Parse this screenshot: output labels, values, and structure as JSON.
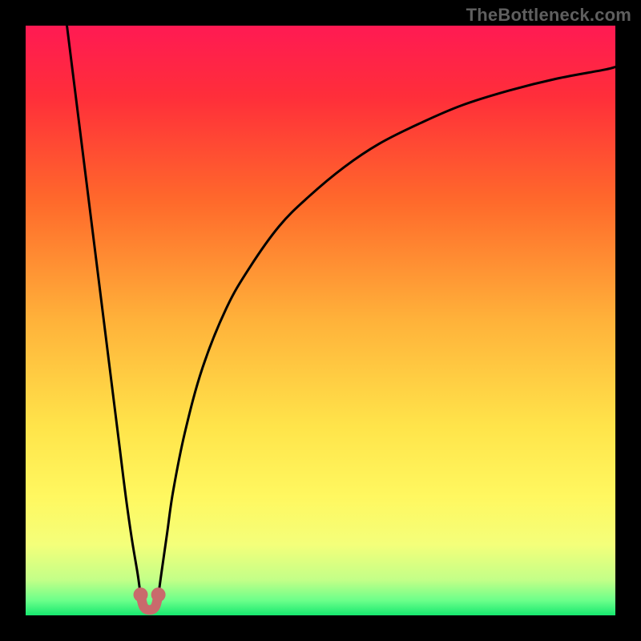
{
  "watermark": "TheBottleneck.com",
  "colors": {
    "frame": "#000000",
    "gradient_stops": [
      {
        "offset": 0.0,
        "color": "#ff1a53"
      },
      {
        "offset": 0.12,
        "color": "#ff2e3a"
      },
      {
        "offset": 0.3,
        "color": "#ff6a2b"
      },
      {
        "offset": 0.5,
        "color": "#ffb23a"
      },
      {
        "offset": 0.68,
        "color": "#ffe44a"
      },
      {
        "offset": 0.8,
        "color": "#fff860"
      },
      {
        "offset": 0.88,
        "color": "#f4ff7a"
      },
      {
        "offset": 0.94,
        "color": "#c3ff88"
      },
      {
        "offset": 0.975,
        "color": "#6bff8a"
      },
      {
        "offset": 1.0,
        "color": "#17e86f"
      }
    ],
    "curve": "#000000",
    "marker_fill": "#c96a6c",
    "marker_stroke": "#c96a6c"
  },
  "chart_data": {
    "type": "line",
    "title": "",
    "xlabel": "",
    "ylabel": "",
    "xlim": [
      0,
      100
    ],
    "ylim": [
      0,
      100
    ],
    "series": [
      {
        "name": "left-branch",
        "x": [
          7,
          8,
          9,
          10,
          11,
          12,
          13,
          14,
          15,
          16,
          17,
          18,
          19,
          19.5,
          20
        ],
        "values": [
          100,
          92,
          84,
          76,
          68,
          60,
          52,
          44,
          36,
          28,
          20,
          13,
          7,
          3.5,
          1.5
        ]
      },
      {
        "name": "right-branch",
        "x": [
          22,
          22.5,
          23,
          24,
          25,
          27,
          30,
          34,
          38,
          43,
          48,
          54,
          60,
          67,
          74,
          82,
          90,
          98,
          100
        ],
        "values": [
          1.5,
          3.5,
          7,
          14,
          21,
          31,
          42,
          52,
          59,
          66,
          71,
          76,
          80,
          83.5,
          86.5,
          89,
          91,
          92.5,
          93
        ]
      }
    ],
    "markers": {
      "name": "minimum-markers",
      "x": [
        19.5,
        22.5
      ],
      "values": [
        3.5,
        3.5
      ]
    },
    "minimum_connector": {
      "x": [
        19.5,
        20,
        21,
        22,
        22.5
      ],
      "values": [
        3.5,
        1.5,
        0.9,
        1.5,
        3.5
      ]
    }
  }
}
